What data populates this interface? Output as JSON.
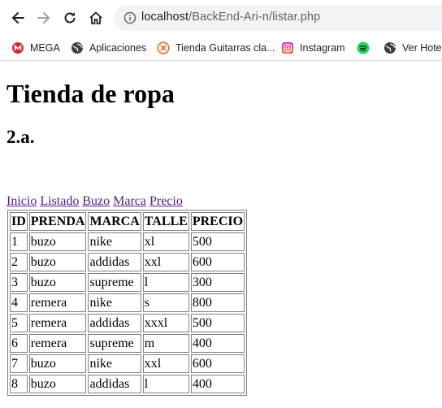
{
  "browser": {
    "url_host": "localhost",
    "url_path": "/BackEnd-Ari-n/listar.php"
  },
  "bookmarks": [
    {
      "label": "MEGA",
      "icon": "mega-icon"
    },
    {
      "label": "Aplicaciones",
      "icon": "globe-icon"
    },
    {
      "label": "Tienda Guitarras cla...",
      "icon": "guitar-store-icon"
    },
    {
      "label": "Instagram",
      "icon": "instagram-icon"
    },
    {
      "label": "",
      "icon": "spotify-icon"
    },
    {
      "label": "Ver Hotel",
      "icon": "globe-icon"
    }
  ],
  "page": {
    "title": "Tienda de ropa",
    "subtitle": "2.a.",
    "nav_links": [
      "Inicio",
      "Listado",
      "Buzo",
      "Marca",
      "Precio"
    ]
  },
  "table": {
    "headers": [
      "ID",
      "PRENDA",
      "MARCA",
      "TALLE",
      "PRECIO"
    ],
    "rows": [
      [
        "1",
        "buzo",
        "nike",
        "xl",
        "500"
      ],
      [
        "2",
        "buzo",
        "addidas",
        "xxl",
        "600"
      ],
      [
        "3",
        "buzo",
        "supreme",
        "l",
        "300"
      ],
      [
        "4",
        "remera",
        "nike",
        "s",
        "800"
      ],
      [
        "5",
        "remera",
        "addidas",
        "xxxl",
        "500"
      ],
      [
        "6",
        "remera",
        "supreme",
        "m",
        "400"
      ],
      [
        "7",
        "buzo",
        "nike",
        "xxl",
        "600"
      ],
      [
        "8",
        "buzo",
        "addidas",
        "l",
        "400"
      ]
    ]
  }
}
